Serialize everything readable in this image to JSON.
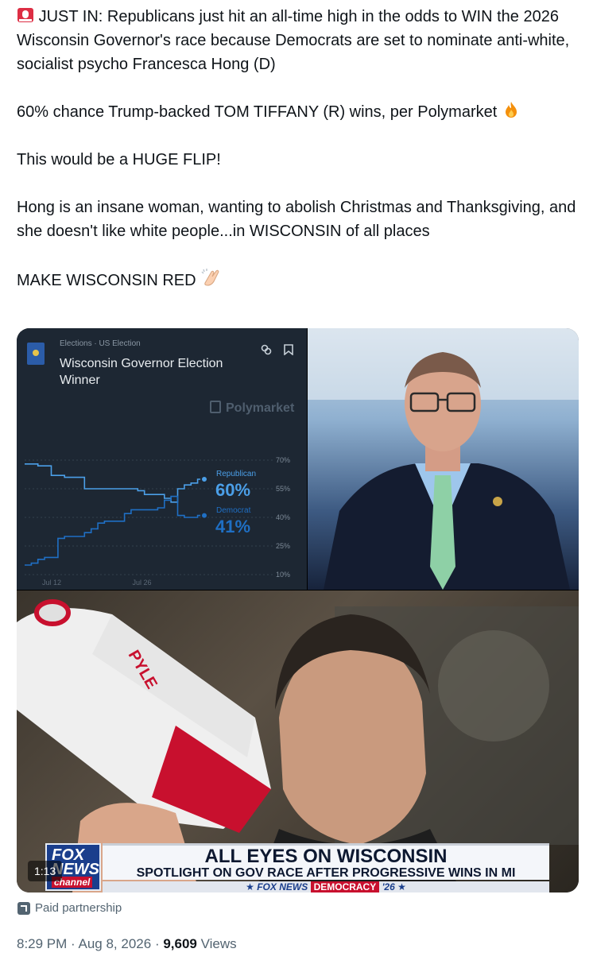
{
  "tweet": {
    "siren_emoji": "siren-icon",
    "line1": "JUST IN: Republicans just hit an all-time high in the odds to WIN the 2026 Wisconsin Governor's race because Democrats are set to nominate anti-white, socialist psycho Francesca Hong (D)",
    "line2": "60% chance Trump-backed TOM TIFFANY (R) wins, per Polymarket",
    "line3": "This would be a HUGE FLIP!",
    "line4": "Hong is an insane woman, wanting to abolish Christmas and Thanksgiving, and she doesn't like white people...in WISCONSIN of all places",
    "line5": "MAKE WISCONSIN RED"
  },
  "chart_panel": {
    "breadcrumb": "Elections · US Election",
    "title": "Wisconsin Governor Election Winner",
    "brand": "Polymarket",
    "republican_label": "Republican",
    "republican_value": "60%",
    "democrat_label": "Democrat",
    "democrat_value": "41%"
  },
  "chart_data": {
    "type": "line",
    "x_ticks": [
      "Jul 12",
      "Jul 26"
    ],
    "y_ticks": [
      "70%",
      "55%",
      "40%",
      "25%",
      "10%"
    ],
    "ylim": [
      10,
      70
    ],
    "grid": true,
    "series": [
      {
        "name": "Republican",
        "color": "#4b9fe8",
        "values": [
          68,
          68,
          67,
          67,
          62,
          62,
          61,
          61,
          61,
          55,
          55,
          55,
          55,
          55,
          55,
          55,
          55,
          54,
          52,
          52,
          52,
          50,
          48,
          55,
          57,
          58,
          60,
          60
        ]
      },
      {
        "name": "Democrat",
        "color": "#1f6fc4",
        "values": [
          15,
          16,
          18,
          19,
          19,
          29,
          30,
          30,
          30,
          32,
          34,
          37,
          38,
          38,
          38,
          42,
          44,
          44,
          44,
          44,
          45,
          49,
          51,
          41,
          40,
          40,
          41,
          41
        ]
      }
    ]
  },
  "fox_banner": {
    "logo_line1": "FOX",
    "logo_line2": "NEWS",
    "logo_line3": "channel",
    "headline": "ALL EYES ON WISCONSIN",
    "subhead": "SPOTLIGHT ON GOV RACE AFTER PROGRESSIVE WINS IN MI",
    "bar_brand": "FOX NEWS",
    "bar_badge": "DEMOCRACY",
    "bar_year": "'26"
  },
  "video": {
    "time": "1:13"
  },
  "paid_partnership": "Paid partnership",
  "meta": {
    "time": "8:29 PM",
    "date": "Aug 8, 2026",
    "views": "9,609",
    "views_label": "Views"
  }
}
